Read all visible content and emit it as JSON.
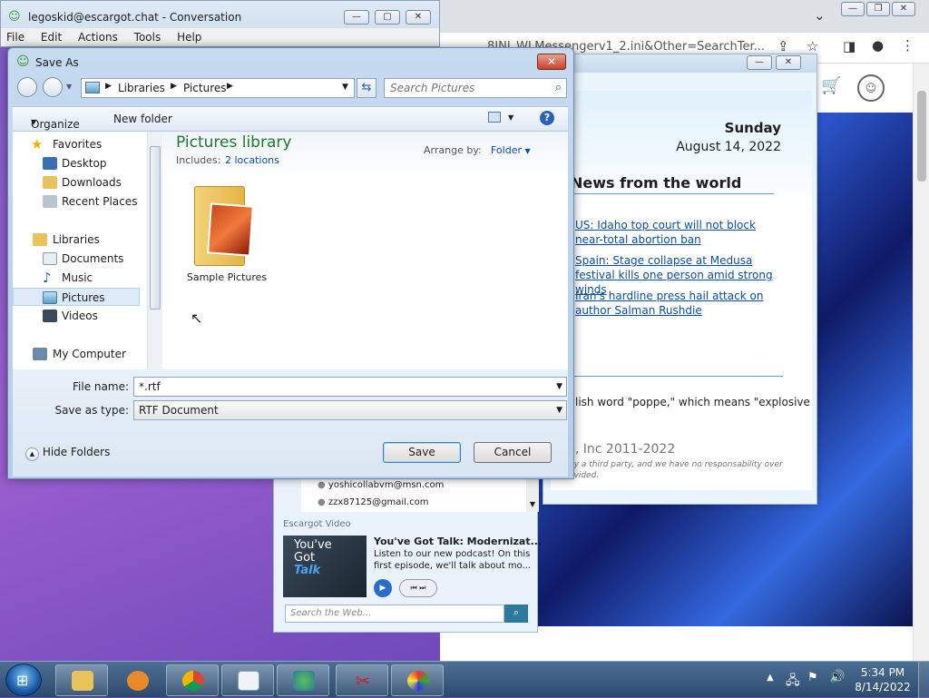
{
  "conversation": {
    "title": "legoskid@escargot.chat - Conversation",
    "menu": [
      "File",
      "Edit",
      "Actions",
      "Tools",
      "Help"
    ]
  },
  "browser": {
    "url_partial": "8INI_WLMessengerv1_2.ini&Other=SearchTer..."
  },
  "news": {
    "day": "Sunday",
    "date": "August 14, 2022",
    "heading": "News from the world",
    "items": [
      "US: Idaho top court will not block near-total abortion ban",
      "Spain: Stage collapse at Medusa festival kills one person amid strong winds",
      "Iran's hardline press hail attack on author Salman Rushdie"
    ],
    "snippet": "lish word \"poppe,\" which means \"explosive",
    "copyright": "p, Inc 2011-2022",
    "disclaimer": "by a third party, and we have no responsability over\novided."
  },
  "messenger": {
    "contacts": [
      "yoshicollabvm@msn.com",
      "zzx87125@gmail.com"
    ],
    "video_label": "Escargot Video",
    "video_title": "You've Got Talk: Modernizat...",
    "video_desc": "Listen to our new podcast! On this first episode, we'll talk about mo...",
    "thumb_text": [
      "You've",
      "Got",
      "Talk"
    ],
    "search_placeholder": "Search the Web..."
  },
  "dialog": {
    "title": "Save As",
    "breadcrumb": [
      "Libraries",
      "Pictures"
    ],
    "search_placeholder": "Search Pictures",
    "toolbar": {
      "organize": "Organize",
      "new_folder": "New folder"
    },
    "nav": {
      "favorites": "Favorites",
      "favorites_items": [
        "Desktop",
        "Downloads",
        "Recent Places"
      ],
      "libraries": "Libraries",
      "libraries_items": [
        "Documents",
        "Music",
        "Pictures",
        "Videos"
      ],
      "computer": "My Computer"
    },
    "library": {
      "title": "Pictures library",
      "includes_label": "Includes:",
      "includes_link": "2 locations",
      "arrange_label": "Arrange by:",
      "arrange_value": "Folder",
      "folder_name": "Sample Pictures"
    },
    "file_name_label": "File name:",
    "file_name_value": "*.rtf",
    "save_type_label": "Save as type:",
    "save_type_value": "RTF Document",
    "hide_folders": "Hide Folders",
    "save": "Save",
    "cancel": "Cancel"
  },
  "taskbar": {
    "time": "5:34 PM",
    "date": "8/14/2022"
  },
  "colors": {
    "link": "#0b4fa3",
    "library_title": "#1e7a2a",
    "close_red": "#c9412a"
  }
}
